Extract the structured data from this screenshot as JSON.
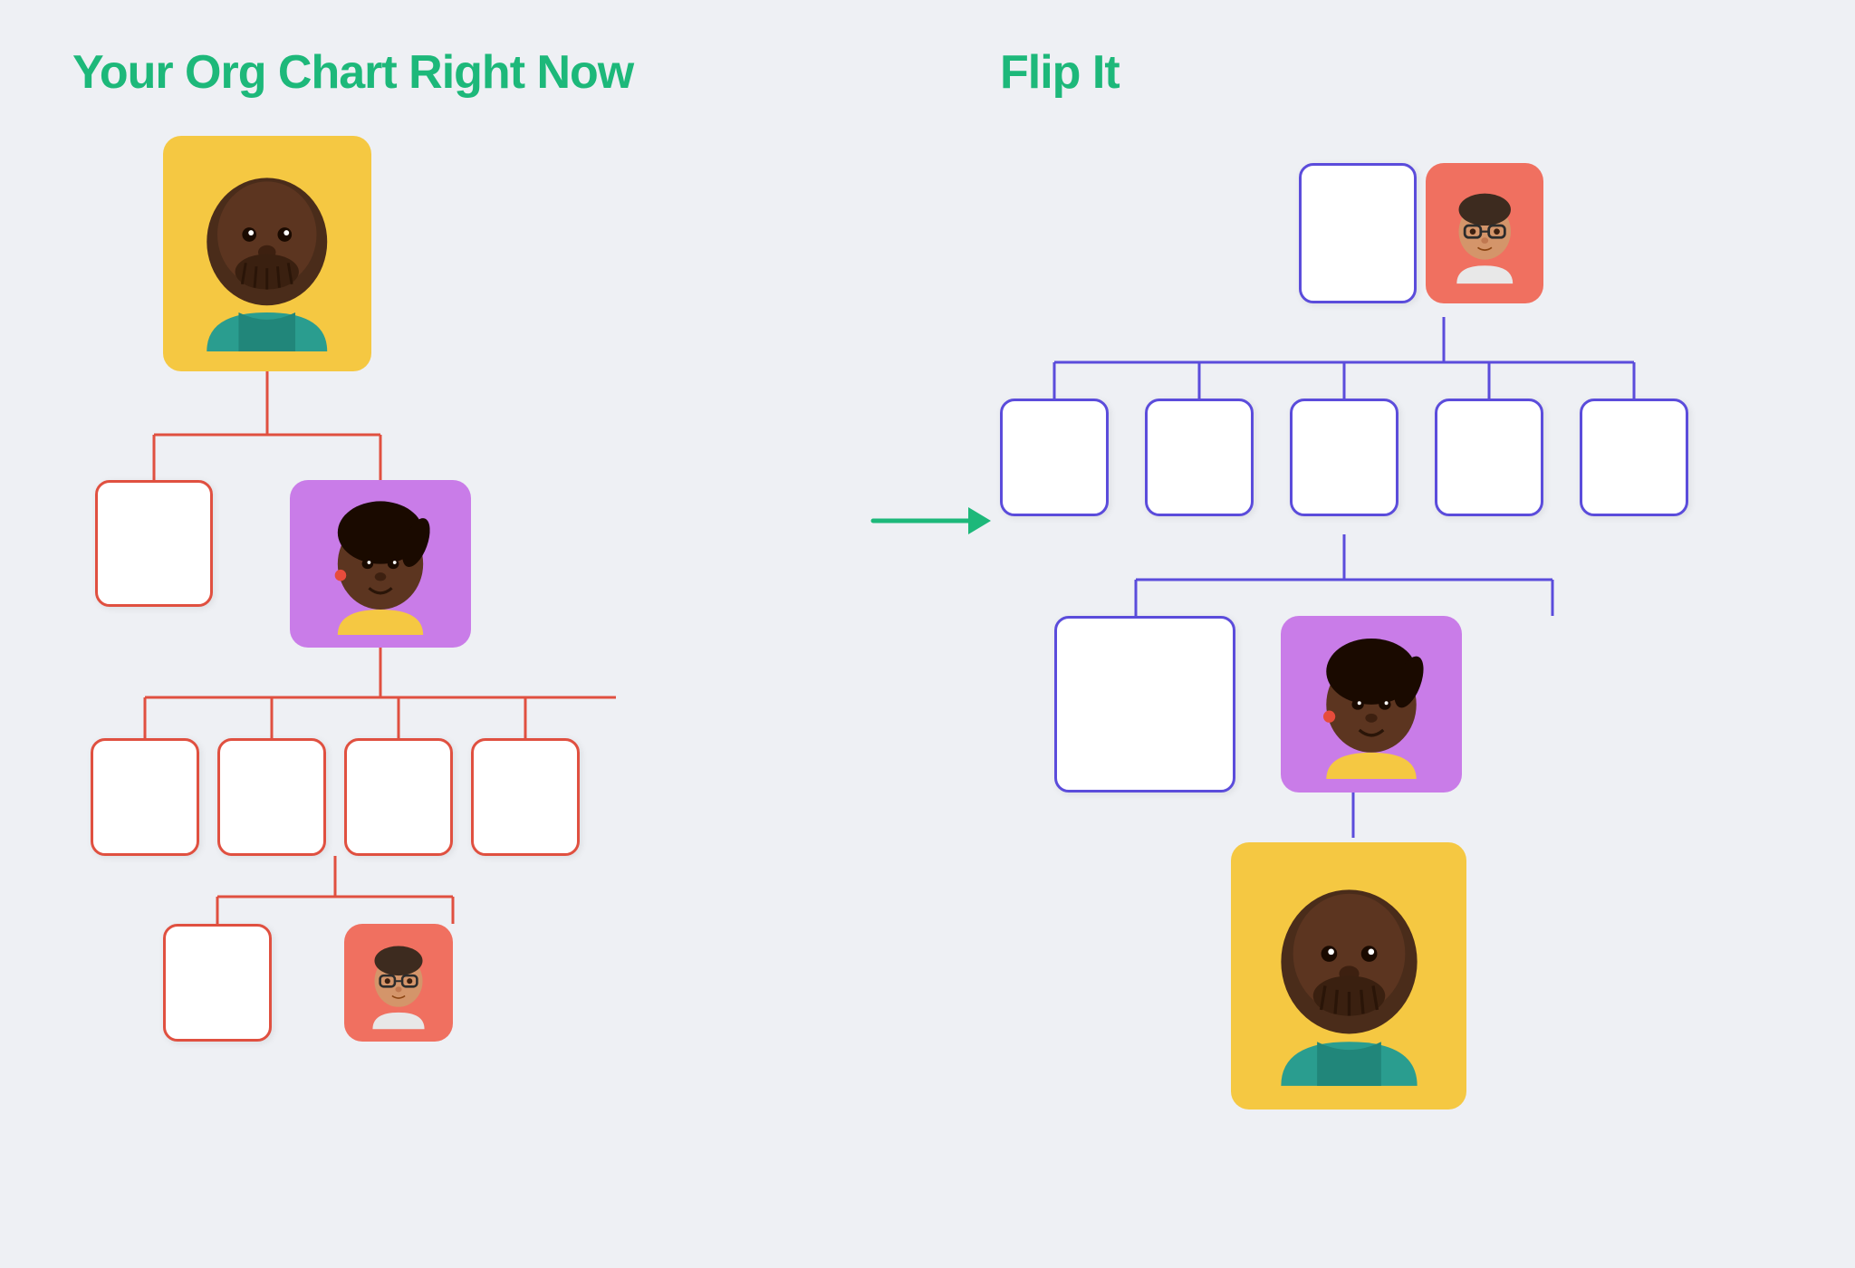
{
  "page": {
    "background_color": "#eef0f4",
    "left_title": "Your Org Chart Right Now",
    "right_title": "Flip It",
    "title_color": "#1db87a",
    "arrow_color": "#1db87a"
  },
  "left_chart": {
    "description": "Top-down org chart with red connector lines",
    "connector_color": "#e05040",
    "nodes": {
      "top": {
        "type": "avatar",
        "bg": "yellow",
        "person": "bald_man"
      },
      "mid_left": {
        "type": "empty",
        "border": "red"
      },
      "mid_right": {
        "type": "avatar",
        "bg": "purple",
        "person": "woman_ponytail"
      },
      "bot_1": {
        "type": "empty",
        "border": "red"
      },
      "bot_2": {
        "type": "empty",
        "border": "red"
      },
      "bot_3": {
        "type": "empty",
        "border": "red"
      },
      "bot_4": {
        "type": "empty",
        "border": "red"
      },
      "bot_bot_1": {
        "type": "empty",
        "border": "red"
      },
      "bot_bot_2": {
        "type": "avatar",
        "bg": "red_avatar",
        "person": "glasses_person"
      }
    }
  },
  "right_chart": {
    "description": "Flipped org chart with purple connector lines",
    "connector_color": "#5b4cdb",
    "nodes": {
      "top_left": {
        "type": "empty",
        "border": "purple"
      },
      "top_right": {
        "type": "avatar",
        "bg": "red_avatar",
        "person": "glasses_person"
      },
      "mid2_1": {
        "type": "empty",
        "border": "purple"
      },
      "mid2_2": {
        "type": "empty",
        "border": "purple"
      },
      "mid2_3": {
        "type": "empty",
        "border": "purple"
      },
      "mid2_4": {
        "type": "empty",
        "border": "purple"
      },
      "mid_left": {
        "type": "empty",
        "border": "purple"
      },
      "mid_right": {
        "type": "avatar",
        "bg": "purple",
        "person": "woman_ponytail"
      },
      "bottom": {
        "type": "avatar",
        "bg": "yellow",
        "person": "bald_man"
      }
    }
  }
}
